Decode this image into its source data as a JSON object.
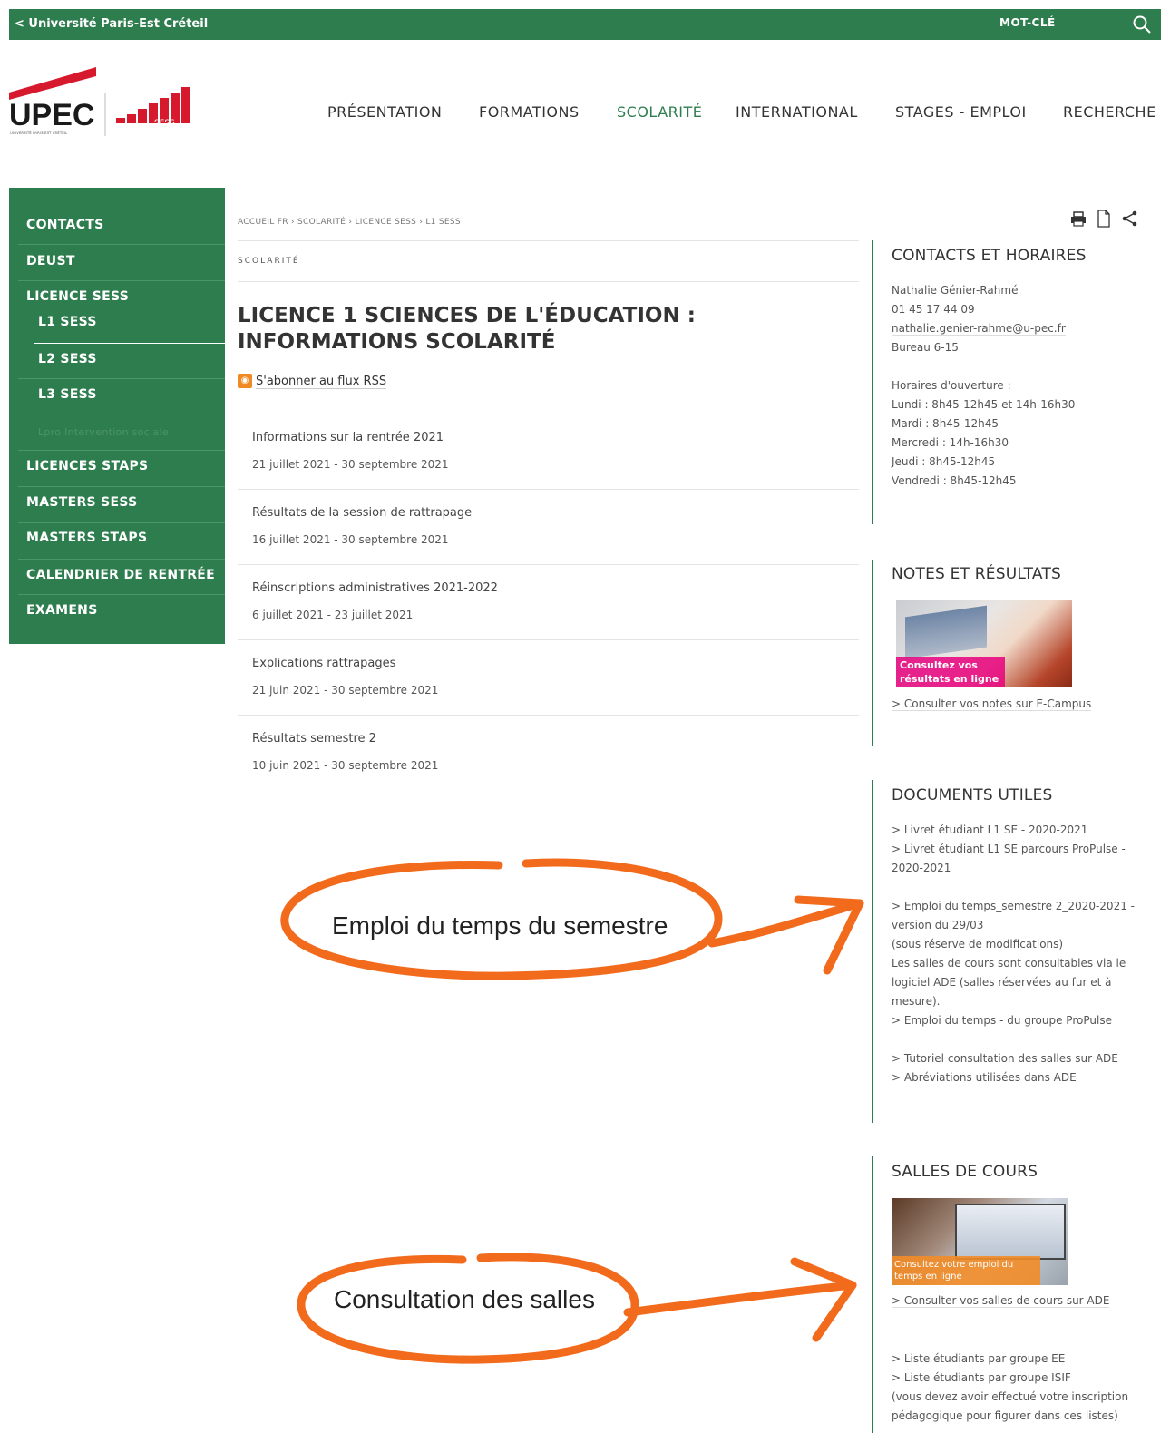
{
  "topbar": {
    "back_label": "< Université Paris-Est Créteil",
    "keyword_label": "MOT-CLÉ",
    "search_icon": "search-icon"
  },
  "logo": {
    "brand": "UPEC",
    "sub": "UNIVERSITÉ PARIS-EST CRÉTEIL",
    "faculty": "SESS STAPS"
  },
  "nav": [
    "PRÉSENTATION",
    "FORMATIONS",
    "SCOLARITÉ",
    "INTERNATIONAL",
    "STAGES - EMPLOI",
    "RECHERCHE"
  ],
  "sidebar": {
    "items": [
      "CONTACTS",
      "DEUST",
      "LICENCE SESS",
      "L1 SESS",
      "L2 SESS",
      "L3 SESS",
      "Lpro Intervention sociale",
      "LICENCES STAPS",
      "MASTERS SESS",
      "MASTERS STAPS",
      "CALENDRIER DE RENTRÉE",
      "EXAMENS"
    ]
  },
  "breadcrumb": "ACCUEIL FR › SCOLARITÉ › LICENCE SESS › L1 SESS",
  "section_label": "SCOLARITÉ",
  "page_title": "LICENCE 1 SCIENCES DE L'ÉDUCATION : INFORMATIONS SCOLARITÉ",
  "rss_label": "S'abonner au flux RSS",
  "news": [
    {
      "title": "Informations sur la rentrée 2021",
      "date": "21 juillet 2021 - 30 septembre 2021"
    },
    {
      "title": "Résultats de la session de rattrapage",
      "date": "16 juillet 2021 - 30 septembre 2021"
    },
    {
      "title": "Réinscriptions administratives 2021-2022",
      "date": "6 juillet 2021 - 23 juillet 2021"
    },
    {
      "title": "Explications rattrapages",
      "date": "21 juin 2021 - 30 septembre 2021"
    },
    {
      "title": "Résultats semestre 2",
      "date": "10 juin 2021 - 30 septembre 2021"
    }
  ],
  "contacts": {
    "heading": "CONTACTS ET HORAIRES",
    "name": "Nathalie Génier-Rahmé",
    "phone": "01 45 17 44 09",
    "email": "nathalie.genier-rahme@u-pec.fr",
    "office": "Bureau 6-15",
    "hours_label": "Horaires d'ouverture :",
    "hours": [
      "Lundi : 8h45-12h45 et 14h-16h30",
      "Mardi : 8h45-12h45",
      "Mercredi : 14h-16h30",
      "Jeudi : 8h45-12h45",
      "Vendredi : 8h45-12h45"
    ]
  },
  "notes": {
    "heading": "NOTES ET RÉSULTATS",
    "image_caption": "Consultez vos résultats en ligne",
    "link": "> Consulter vos notes sur E-Campus"
  },
  "documents": {
    "heading": "DOCUMENTS UTILES",
    "link1": "> Livret étudiant L1 SE - 2020-2021",
    "link2a": "> Livret étudiant L1 SE parcours ProPulse -",
    "link2b": "2020-2021",
    "link3a": "> Emploi du temps_semestre 2_2020-2021 -",
    "link3b": "version du 29/03",
    "note1": "(sous réserve de modifications)",
    "note2": "Les salles de cours sont consultables via le",
    "note3": "logiciel ADE (salles réservées au fur et à",
    "note4": "mesure).",
    "link4": "> Emploi du temps - du groupe ProPulse",
    "link5": "> Tutoriel consultation des salles sur ADE",
    "link6": "> Abréviations utilisées dans ADE"
  },
  "salles": {
    "heading": "SALLES DE COURS",
    "image_caption": "Consultez votre emploi du temps en ligne",
    "link": "> Consulter vos salles de cours sur ADE",
    "list1": "> Liste étudiants par groupe EE",
    "list2": "> Liste étudiants par groupe ISIF",
    "note1": "(vous devez avoir effectué votre inscription",
    "note2": "pédagogique pour figurer dans ces listes)"
  },
  "annotations": {
    "anno1": "Emploi du temps du semestre",
    "anno2": "Consultation des salles",
    "color": "#f26b1d"
  },
  "colors": {
    "brand_green": "#2e7d4f",
    "upec_red": "#d7192d"
  }
}
